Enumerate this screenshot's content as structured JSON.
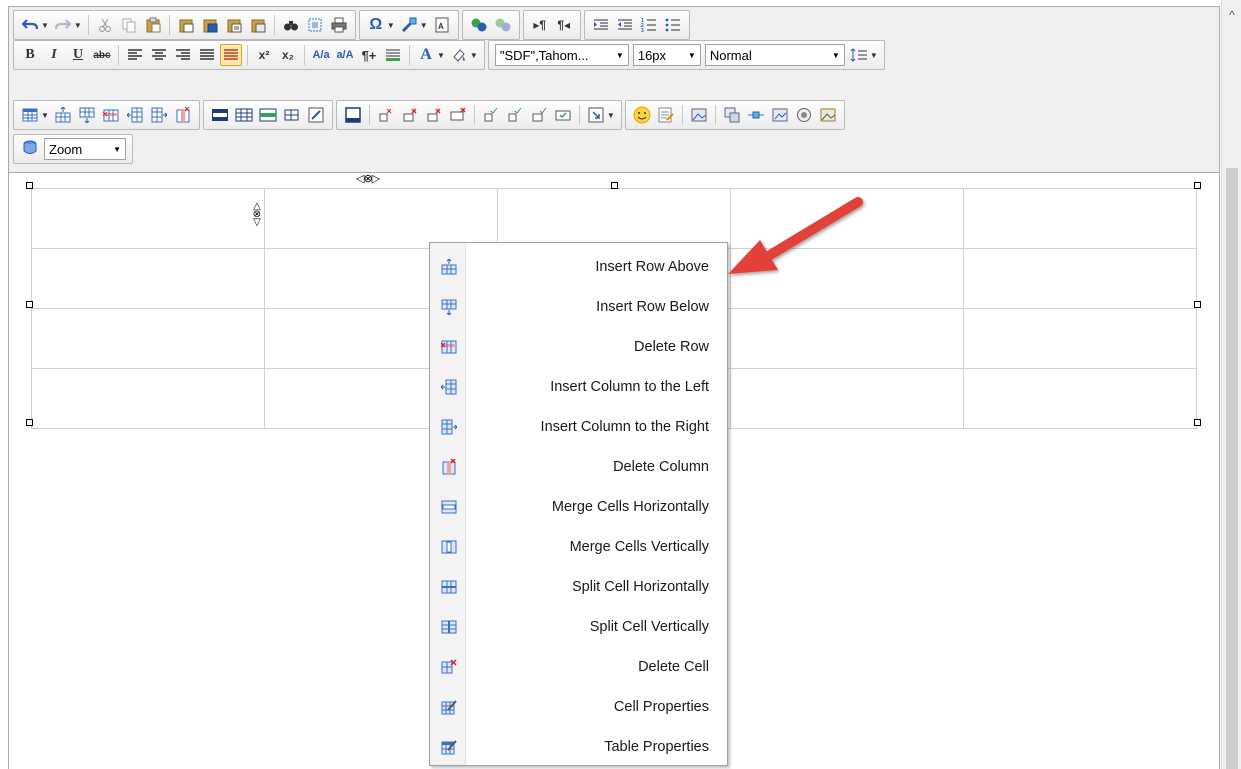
{
  "toolbar": {
    "font_family_value": "\"SDF\",Tahom...",
    "font_size_value": "16px",
    "format_value": "Normal",
    "zoom_label": "Zoom",
    "bold_glyph": "B",
    "italic_glyph": "I",
    "underline_glyph": "U",
    "strike_glyph": "abc",
    "superscript_glyph": "x²",
    "subscript_glyph": "x₂",
    "omega_glyph": "Ω",
    "font_color_glyph": "A"
  },
  "context_menu": {
    "items": [
      {
        "label": "Insert Row Above",
        "icon": "insert-row-above-icon"
      },
      {
        "label": "Insert Row Below",
        "icon": "insert-row-below-icon"
      },
      {
        "label": "Delete Row",
        "icon": "delete-row-icon"
      },
      {
        "label": "Insert Column to the Left",
        "icon": "insert-column-left-icon"
      },
      {
        "label": "Insert Column to the Right",
        "icon": "insert-column-right-icon"
      },
      {
        "label": "Delete Column",
        "icon": "delete-column-icon"
      },
      {
        "label": "Merge Cells Horizontally",
        "icon": "merge-cells-horizontally-icon"
      },
      {
        "label": "Merge Cells Vertically",
        "icon": "merge-cells-vertically-icon"
      },
      {
        "label": "Split Cell Horizontally",
        "icon": "split-cell-horizontally-icon"
      },
      {
        "label": "Split Cell Vertically",
        "icon": "split-cell-vertically-icon"
      },
      {
        "label": "Delete Cell",
        "icon": "delete-cell-icon"
      },
      {
        "label": "Cell Properties",
        "icon": "cell-properties-icon"
      },
      {
        "label": "Table Properties",
        "icon": "table-properties-icon"
      }
    ]
  },
  "colors": {
    "arrow": "#e2413a",
    "toolbar_bg": "#f0f0f0",
    "table_icon_blue": "#3a6fc4"
  }
}
